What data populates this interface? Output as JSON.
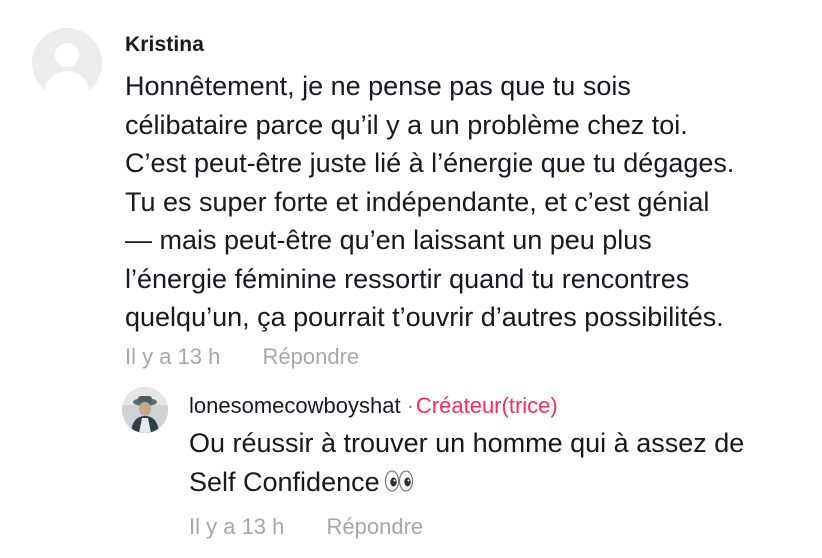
{
  "comment": {
    "author": "Kristina",
    "text_lines": [
      "Honnêtement, je ne pense pas que tu sois",
      "célibataire parce qu’il y a un problème chez toi.",
      "C’est peut-être juste lié à l’énergie que tu dégages.",
      "Tu es super forte et indépendante, et c’est génial",
      "— mais peut-être qu’en laissant un peu plus",
      "l’énergie féminine ressortir quand tu rencontres",
      "quelqu’un, ça pourrait t’ouvrir d’autres possibilités."
    ],
    "time": "Il y a 13 h",
    "reply_label": "Répondre"
  },
  "reply": {
    "author": "lonesomecowboyshat",
    "separator": "·",
    "creator_badge": "Créateur(trice)",
    "text_lines": [
      "Ou réussir à trouver un homme qui à assez de",
      "Self Confidence"
    ],
    "emoji": "eyes-emoji",
    "time": "Il y a 13 h",
    "reply_label": "Répondre"
  },
  "colors": {
    "text": "#161823",
    "muted": "#a7a7ab",
    "creator_badge": "#fe2c55",
    "avatar_placeholder": "#ececec"
  }
}
